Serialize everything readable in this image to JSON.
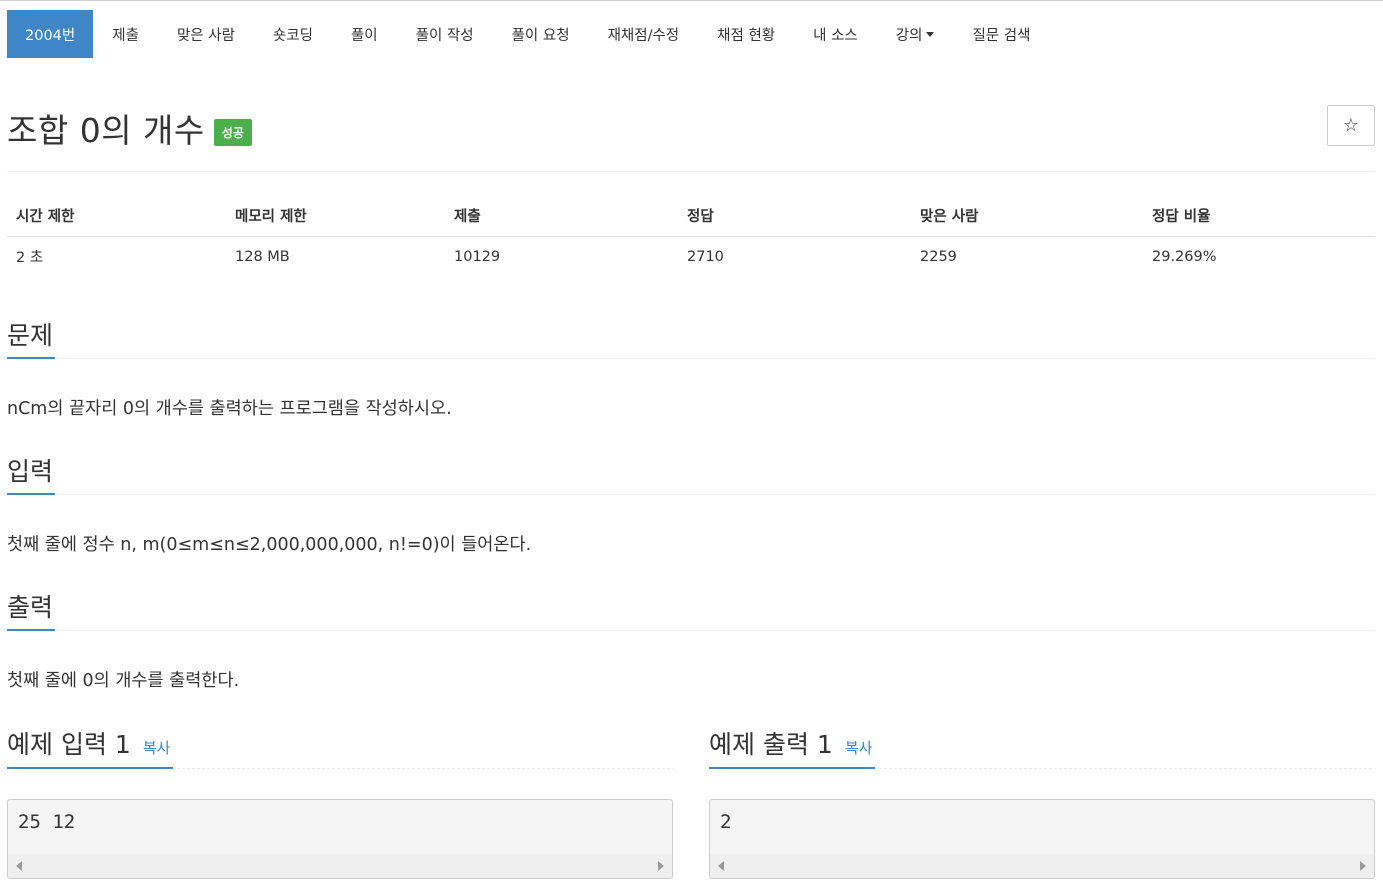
{
  "nav": {
    "items": [
      {
        "label": "2004번"
      },
      {
        "label": "제출"
      },
      {
        "label": "맞은 사람"
      },
      {
        "label": "숏코딩"
      },
      {
        "label": "풀이"
      },
      {
        "label": "풀이 작성"
      },
      {
        "label": "풀이 요청"
      },
      {
        "label": "재채점/수정"
      },
      {
        "label": "채점 현황"
      },
      {
        "label": "내 소스"
      },
      {
        "label": "강의"
      },
      {
        "label": "질문 검색"
      }
    ]
  },
  "problem": {
    "title": "조합 0의 개수",
    "badge": "성공",
    "star_icon": "☆"
  },
  "info": {
    "headers": [
      "시간 제한",
      "메모리 제한",
      "제출",
      "정답",
      "맞은 사람",
      "정답 비율"
    ],
    "values": [
      "2 초",
      "128 MB",
      "10129",
      "2710",
      "2259",
      "29.269%"
    ]
  },
  "sections": {
    "problem": {
      "heading": "문제",
      "text": "nCm의 끝자리 0의 개수를 출력하는 프로그램을 작성하시오."
    },
    "input": {
      "heading": "입력",
      "text": "첫째 줄에 정수 n, m(0≤m≤n≤2,000,000,000, n!=0)이 들어온다."
    },
    "output": {
      "heading": "출력",
      "text": "첫째 줄에 0의 개수를 출력한다."
    }
  },
  "examples": {
    "input": {
      "heading": "예제 입력 1",
      "copy": "복사",
      "content": "25 12"
    },
    "output": {
      "heading": "예제 출력 1",
      "copy": "복사",
      "content": "2"
    }
  },
  "colors": {
    "accent": "#3e86c8",
    "success": "#4cae4c"
  }
}
